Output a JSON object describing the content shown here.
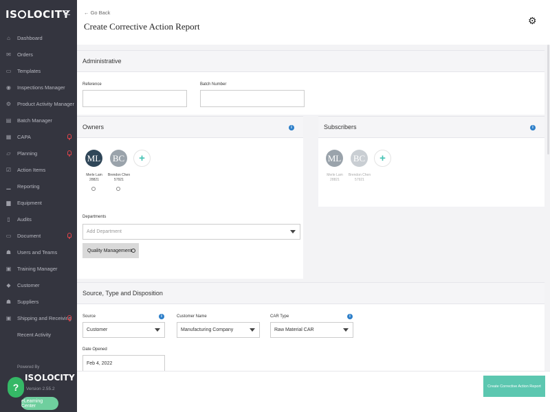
{
  "sidebar": {
    "logo": {
      "pre": "IS",
      "post": "LOCITY"
    },
    "items": [
      {
        "label": "Dashboard",
        "icon": "home-icon",
        "glyph": "⌂",
        "alert": false
      },
      {
        "label": "Orders",
        "icon": "envelope-icon",
        "glyph": "✉",
        "alert": false
      },
      {
        "label": "Templates",
        "icon": "templates-icon",
        "glyph": "▭",
        "alert": false
      },
      {
        "label": "Inspections Manager",
        "icon": "gauge-icon",
        "glyph": "◉",
        "alert": false
      },
      {
        "label": "Product Activity Manager",
        "icon": "gear-icon",
        "glyph": "⚙",
        "alert": false
      },
      {
        "label": "Batch Manager",
        "icon": "batch-icon",
        "glyph": "▤",
        "alert": false
      },
      {
        "label": "CAPA",
        "icon": "capa-icon",
        "glyph": "▦",
        "alert": true
      },
      {
        "label": "Planning",
        "icon": "map-icon",
        "glyph": "▱",
        "alert": true
      },
      {
        "label": "Action Items",
        "icon": "check-icon",
        "glyph": "☑",
        "alert": false
      },
      {
        "label": "Reporting",
        "icon": "chart-icon",
        "glyph": "▁",
        "alert": false
      },
      {
        "label": "Equipment",
        "icon": "truck-icon",
        "glyph": "▆",
        "alert": false
      },
      {
        "label": "Audits",
        "icon": "file-icon",
        "glyph": "▯",
        "alert": false
      },
      {
        "label": "Document",
        "icon": "folder-icon",
        "glyph": "▭",
        "alert": true
      },
      {
        "label": "Users and Teams",
        "icon": "users-icon",
        "glyph": "☗",
        "alert": false
      },
      {
        "label": "Training Manager",
        "icon": "training-icon",
        "glyph": "▣",
        "alert": false
      },
      {
        "label": "Customer",
        "icon": "tag-icon",
        "glyph": "◆",
        "alert": false
      },
      {
        "label": "Suppliers",
        "icon": "supplier-icon",
        "glyph": "☗",
        "alert": false
      },
      {
        "label": "Shipping and Receiving",
        "icon": "shipping-icon",
        "glyph": "▣",
        "alert": true
      },
      {
        "label": "Recent Activity",
        "icon": "",
        "glyph": "",
        "alert": false
      }
    ],
    "powered_by": "Powered By",
    "footer_logo": {
      "pre": "IS",
      "post": "LOCITY"
    },
    "version": "Version 2.55.2",
    "help": "?",
    "learning_center": "eLearning Center"
  },
  "header": {
    "back": "← Go Back",
    "title": "Create Corrective Action Report"
  },
  "administrative": {
    "heading": "Administrative",
    "reference_label": "Reference",
    "reference_value": "",
    "batch_label": "Batch Number",
    "batch_value": ""
  },
  "owners": {
    "heading": "Owners",
    "people": [
      {
        "initials": "ML",
        "name": "Merle Lam",
        "id": "28821"
      },
      {
        "initials": "BC",
        "name": "Brendon Chen",
        "id": "57921"
      }
    ]
  },
  "subscribers": {
    "heading": "Subscribers",
    "people": [
      {
        "initials": "ML",
        "name": "Merle Lam",
        "id": "28821"
      },
      {
        "initials": "BC",
        "name": "Brendon Chen",
        "id": "57921"
      }
    ]
  },
  "departments": {
    "label": "Departments",
    "placeholder": "Add Department",
    "chips": [
      "Quality Management"
    ]
  },
  "source_section": {
    "heading": "Source, Type and Disposition",
    "source_label": "Source",
    "source_value": "Customer",
    "customer_label": "Customer Name",
    "customer_value": "Manufacturing Company",
    "car_label": "CAR Type",
    "car_value": "Raw Material CAR",
    "date_label": "Date Opened",
    "date_value": "Feb 4, 2022"
  },
  "footer": {
    "submit": "Create Corrective Action Report"
  },
  "colors": {
    "sidebar_bg": "#34353f",
    "accent_teal": "#5cc7b0",
    "alert_red": "#e0434a",
    "info_blue": "#2d7fc9",
    "avatar_dark": "#2f4658",
    "avatar_gray": "#9aa3ab"
  }
}
